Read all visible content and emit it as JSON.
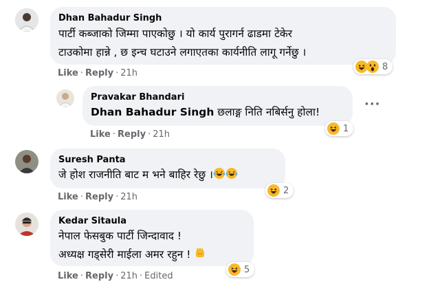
{
  "comments": [
    {
      "author": "Dhan Bahadur Singh",
      "line1": "पार्टी कब्जाको जिम्मा पाएकोछु । यो कार्य पुरागर्न ढाडमा टेकेर",
      "line2": "टाउकोमा हान्ने , छ इन्च घटाउने लगाएतका कार्यनीति लागू गर्नेछु ।",
      "like": "Like",
      "reply": "Reply",
      "time": "21h",
      "reaction_count": "8",
      "reactions": [
        "haha-icon",
        "wow-icon"
      ]
    },
    {
      "author": "Pravakar Bhandari",
      "tag": "Dhan Bahadur Singh",
      "text": " छलाङ्ग निति नबिर्सनु होला!",
      "like": "Like",
      "reply": "Reply",
      "time": "21h",
      "reaction_count": "1",
      "reactions": [
        "haha-icon"
      ],
      "more_label": "···"
    },
    {
      "author": "Suresh Panta",
      "text": "जे होश राजनीति बाट म भने बाहिर रेछु ।",
      "inline_emojis": [
        "laughing-crying-icon",
        "laughing-crying-icon"
      ],
      "like": "Like",
      "reply": "Reply",
      "time": "21h",
      "reaction_count": "2",
      "reactions": [
        "haha-icon"
      ]
    },
    {
      "author": "Kedar Sitaula",
      "line1": "नेपाल फेसबुक पार्टी जिन्दावाद !",
      "line2": "अध्यक्ष गड्सेरी माईला अमर रहुन !",
      "inline_emojis": [
        "raised-fist-icon"
      ],
      "like": "Like",
      "reply": "Reply",
      "time": "21h",
      "edited": "Edited",
      "reaction_count": "5",
      "reactions": [
        "haha-icon"
      ]
    }
  ],
  "colors": {
    "bubble": "#f0f2f5",
    "meta": "#65676b",
    "text": "#050505",
    "reaction_yellow": "#f7b928"
  }
}
